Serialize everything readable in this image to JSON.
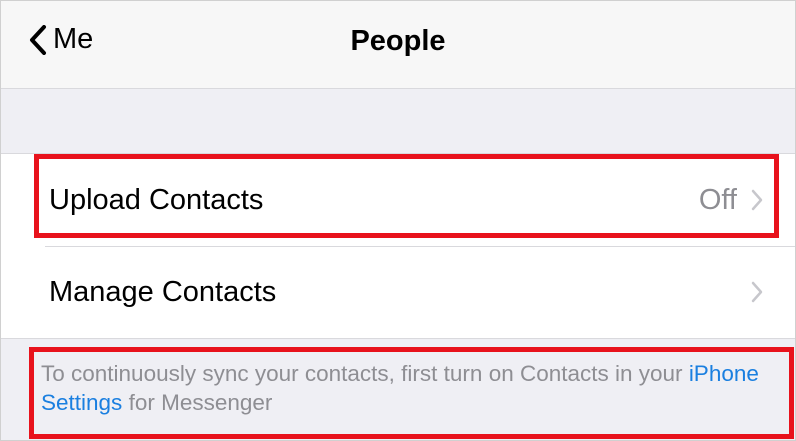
{
  "nav": {
    "back_label": "Me",
    "title": "People",
    "back_icon": "chevron-left-icon"
  },
  "rows": [
    {
      "label": "Upload Contacts",
      "value": "Off",
      "icon": "chevron-right-icon"
    },
    {
      "label": "Manage Contacts",
      "value": "",
      "icon": "chevron-right-icon"
    }
  ],
  "footer": {
    "text_before": "To continuously sync your contacts, first turn on Contacts in your ",
    "link": "iPhone Settings",
    "text_after": " for Messenger"
  },
  "colors": {
    "link": "#1a7fe0",
    "secondary_text": "#8e8e93",
    "highlight": "#e8121c",
    "background": "#efeff4"
  }
}
